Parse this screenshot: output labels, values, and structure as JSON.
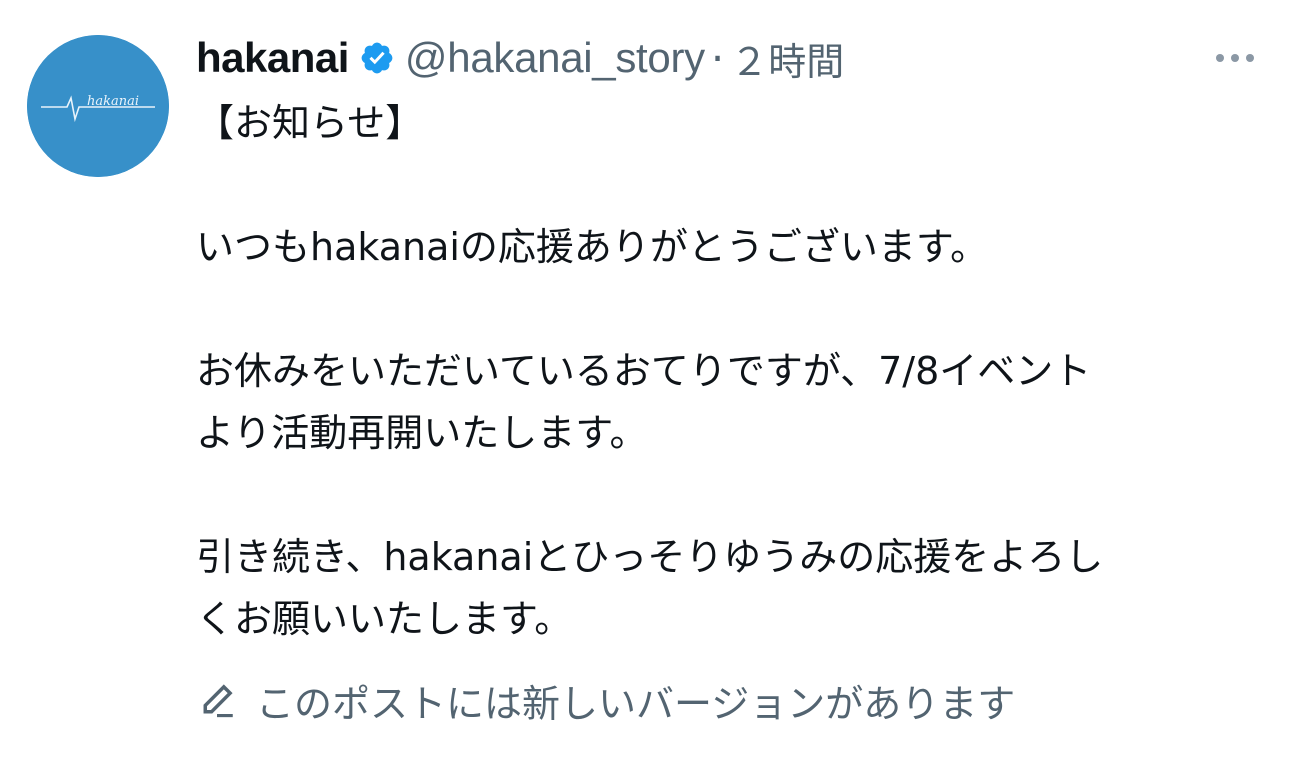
{
  "post": {
    "author": {
      "display_name": "hakanai",
      "verified": true,
      "handle": "@hakanai_story",
      "separator": "·",
      "timestamp": "２時間",
      "avatar_text": "hakanai",
      "avatar_color": "#3790c9"
    },
    "body_lines": [
      {
        "text": "【お知らせ】"
      },
      {
        "text": ""
      },
      {
        "text": "いつもhakanaiの応援ありがとうございます。"
      },
      {
        "text": ""
      },
      {
        "text": "お休みをいただいているおてりですが、7/8イベント"
      },
      {
        "text": "より活動再開いたします。"
      },
      {
        "text": ""
      },
      {
        "text": "引き続き、hakanaiとひっそりゆうみの応援をよろし"
      },
      {
        "text": "くお願いいたします。"
      }
    ],
    "edit_notice": {
      "icon": "pencil-icon",
      "text": "このポストには新しいバージョンがあります"
    },
    "more_icon": "more-options-icon"
  },
  "colors": {
    "text_primary": "#0f1419",
    "text_secondary": "#536471",
    "verified_blue": "#1d9bf0"
  }
}
